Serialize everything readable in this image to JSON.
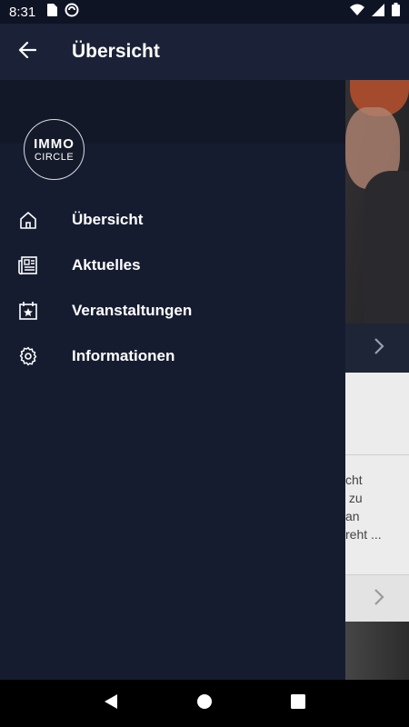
{
  "status_bar": {
    "time": "8:31",
    "icons": [
      "sd-card-icon",
      "sync-icon",
      "wifi-icon",
      "signal-icon",
      "battery-icon"
    ]
  },
  "app_bar": {
    "title": "Übersicht",
    "back_icon": "arrow-back-icon"
  },
  "logo": {
    "line1": "IMMO",
    "line2": "CIRCLE"
  },
  "drawer": {
    "items": [
      {
        "label": "Übersicht",
        "icon": "home-icon"
      },
      {
        "label": "Aktuelles",
        "icon": "newspaper-icon"
      },
      {
        "label": "Veranstaltungen",
        "icon": "calendar-star-icon"
      },
      {
        "label": "Informationen",
        "icon": "gear-icon"
      }
    ]
  },
  "background": {
    "card_text": "cht\n zu\nan\nreht ..."
  },
  "nav_bar": {
    "buttons": [
      "back-triangle-icon",
      "home-circle-icon",
      "recents-square-icon"
    ]
  },
  "colors": {
    "drawer_bg": "#161c30",
    "app_bar_bg": "#1b2237",
    "status_bar_bg": "#0f1424",
    "text": "#ffffff"
  }
}
